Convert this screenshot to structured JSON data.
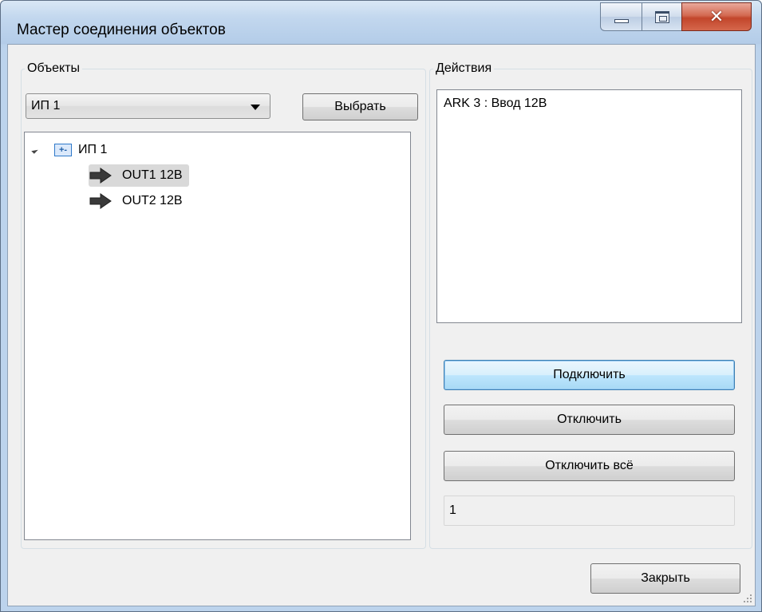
{
  "window": {
    "title": "Мастер соединения объектов"
  },
  "objects_group": {
    "legend": "Объекты",
    "combo_value": "ИП 1",
    "select_button": "Выбрать",
    "tree": {
      "root_label": "ИП 1",
      "children": [
        {
          "label": "OUT1 12В",
          "selected": true
        },
        {
          "label": "OUT2 12В",
          "selected": false
        }
      ]
    }
  },
  "actions_group": {
    "legend": "Действия",
    "list_items": [
      "ARK 3 : Ввод 12В"
    ],
    "connect_button": "Подключить",
    "disconnect_button": "Отключить",
    "disconnect_all_button": "Отключить всё",
    "count_value": "1"
  },
  "footer": {
    "close_button": "Закрыть"
  }
}
